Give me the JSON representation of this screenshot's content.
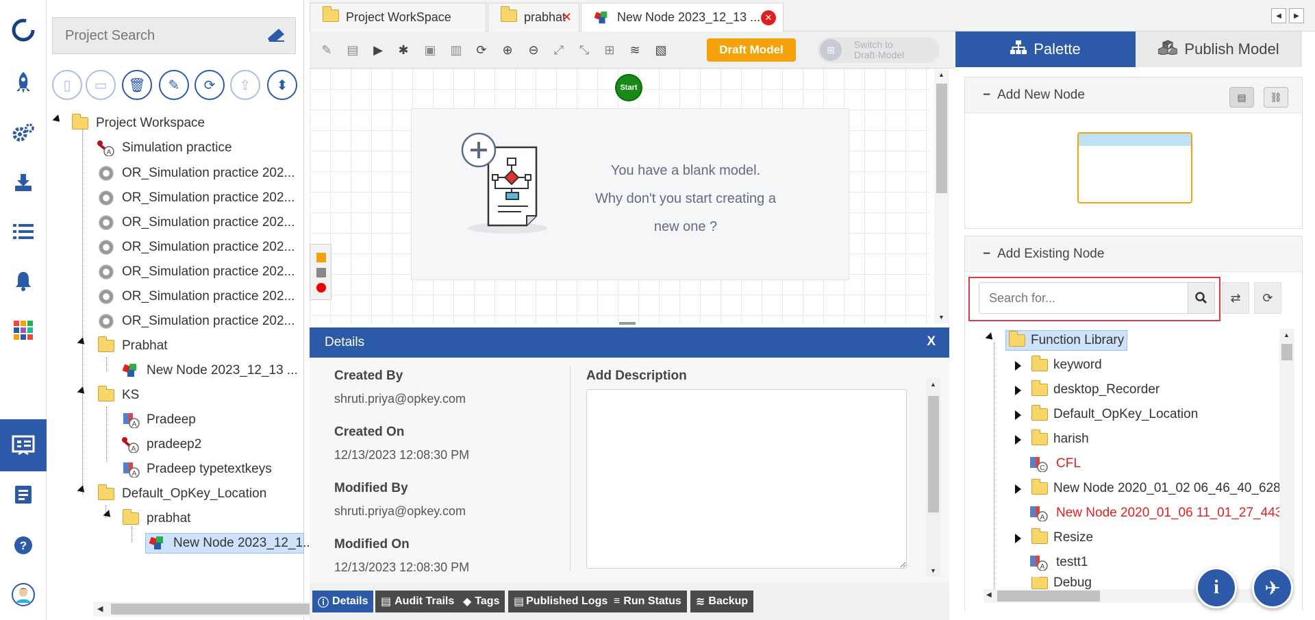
{
  "explorer": {
    "search_placeholder": "Project Search",
    "tree": [
      {
        "label": "Project Workspace",
        "icon": "folder"
      },
      {
        "label": "Simulation practice",
        "icon": "tool-icon"
      },
      {
        "label": "OR_Simulation practice 202...",
        "icon": "gear"
      },
      {
        "label": "OR_Simulation practice 202...",
        "icon": "gear"
      },
      {
        "label": "OR_Simulation practice 202...",
        "icon": "gear"
      },
      {
        "label": "OR_Simulation practice 202...",
        "icon": "gear"
      },
      {
        "label": "OR_Simulation practice 202...",
        "icon": "gear"
      },
      {
        "label": "OR_Simulation practice 202...",
        "icon": "gear"
      },
      {
        "label": "OR_Simulation practice 202...",
        "icon": "gear"
      },
      {
        "label": "Prabhat",
        "icon": "folder"
      },
      {
        "label": "New Node 2023_12_13 ...",
        "icon": "model"
      },
      {
        "label": "KS",
        "icon": "folder"
      },
      {
        "label": "Pradeep",
        "icon": "component"
      },
      {
        "label": "pradeep2",
        "icon": "tool-icon"
      },
      {
        "label": "Pradeep typetextkeys",
        "icon": "component"
      },
      {
        "label": "Default_OpKey_Location",
        "icon": "folder"
      },
      {
        "label": "prabhat",
        "icon": "folder"
      },
      {
        "label": "New Node 2023_12_1...",
        "icon": "model"
      }
    ]
  },
  "tabs": [
    {
      "label": "Project WorkSpace"
    },
    {
      "label": "prabhat"
    },
    {
      "label": "New Node 2023_12_13 ..."
    }
  ],
  "toolbar": {
    "draft_label": "Draft Model",
    "switch_label_1": "Switch to",
    "switch_label_2": "Draft-Model"
  },
  "canvas": {
    "start_label": "Start",
    "blank_line1": "You have a blank model.",
    "blank_line2": "Why don't you start creating a",
    "blank_line3": "new one ?"
  },
  "details": {
    "title": "Details",
    "close": "X",
    "created_by_label": "Created By",
    "created_by": "shruti.priya@opkey.com",
    "created_on_label": "Created On",
    "created_on": "12/13/2023 12:08:30 PM",
    "modified_by_label": "Modified By",
    "modified_by": "shruti.priya@opkey.com",
    "modified_on_label": "Modified On",
    "modified_on": "12/13/2023 12:08:30 PM",
    "description_label": "Add Description",
    "tabs": [
      "Details",
      "Audit Trails",
      "Tags",
      "Published Logs",
      "Run Status",
      "Backup"
    ]
  },
  "right_panel": {
    "palette_tab": "Palette",
    "publish_tab": "Publish Model",
    "add_new_node": "Add New Node",
    "add_existing_node": "Add Existing Node",
    "search_placeholder": "Search for...",
    "tree": [
      {
        "label": "Function Library",
        "color": "normal"
      },
      {
        "label": "keyword",
        "color": "normal"
      },
      {
        "label": "desktop_Recorder",
        "color": "normal"
      },
      {
        "label": "Default_OpKey_Location",
        "color": "normal"
      },
      {
        "label": "harish",
        "color": "normal"
      },
      {
        "label": "CFL",
        "color": "red"
      },
      {
        "label": "New Node 2020_01_02 06_46_40_628",
        "color": "normal"
      },
      {
        "label": "New Node 2020_01_06 11_01_27_443",
        "color": "red"
      },
      {
        "label": "Resize",
        "color": "normal"
      },
      {
        "label": "testt1",
        "color": "normal"
      },
      {
        "label": "Debug",
        "color": "normal"
      }
    ]
  },
  "colors": {
    "primary": "#2c5aa8",
    "draft_orange": "#f5a20a",
    "start_green": "#178a17",
    "error_red": "#e02020"
  }
}
